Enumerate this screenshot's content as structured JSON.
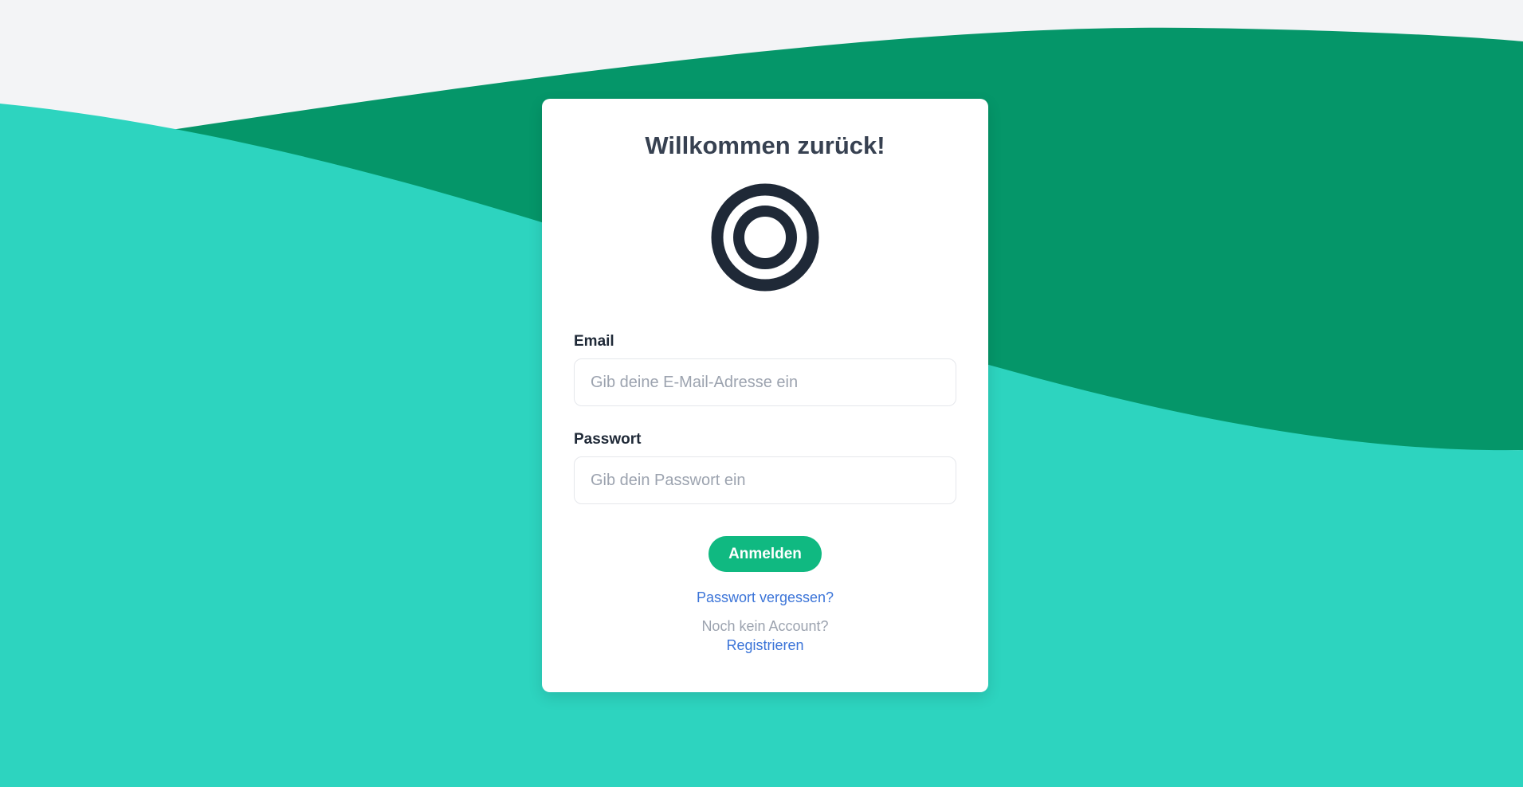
{
  "colors": {
    "page_background": "#f3f4f6",
    "wave_dark": "#059669",
    "wave_light": "#2dd4bf",
    "accent": "#10b981",
    "link": "#3b74d8",
    "logo": "#1f2937"
  },
  "login": {
    "title": "Willkommen zurück!",
    "logo_icon": "concentric-circles-logo",
    "email": {
      "label": "Email",
      "value": "",
      "placeholder": "Gib deine E-Mail-Adresse ein"
    },
    "password": {
      "label": "Passwort",
      "value": "",
      "placeholder": "Gib dein Passwort ein"
    },
    "submit_label": "Anmelden",
    "forgot_password_label": "Passwort vergessen?",
    "no_account_text": "Noch kein Account?",
    "register_label": "Registrieren"
  }
}
